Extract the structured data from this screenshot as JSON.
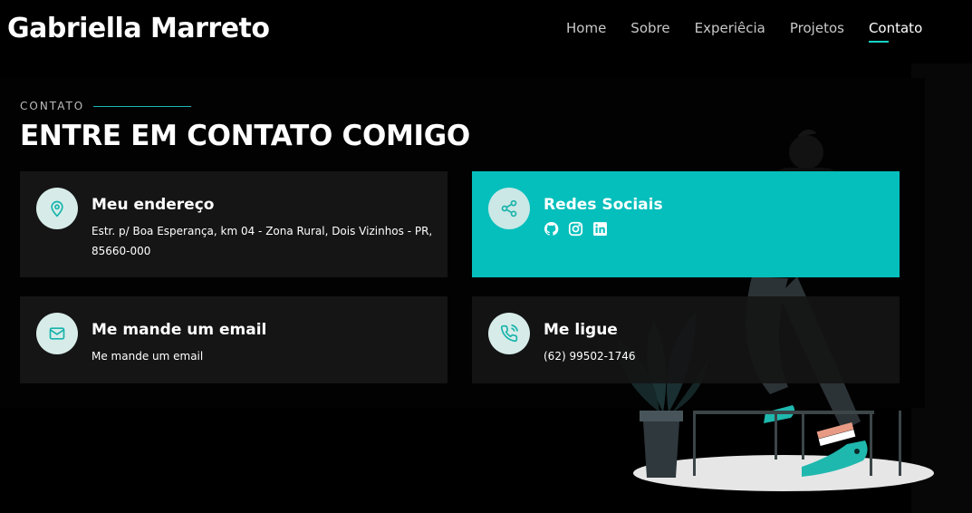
{
  "brand": "Gabriella Marreto",
  "nav": [
    "Home",
    "Sobre",
    "Experiêcia",
    "Projetos",
    "Contato"
  ],
  "nav_active": "Contato",
  "accent": "#18d2c8",
  "card_teal": "#05bfbc",
  "section": {
    "eyebrow": "CONTATO",
    "title": "ENTRE EM CONTATO COMIGO"
  },
  "cards": {
    "address": {
      "icon": "map-pin-icon",
      "title": "Meu endereço",
      "text": "Estr. p/ Boa Esperança, km 04 - Zona Rural, Dois Vizinhos - PR, 85660-000"
    },
    "social": {
      "icon": "share-icon",
      "title": "Redes Sociais",
      "links": [
        "github-icon",
        "instagram-icon",
        "linkedin-icon"
      ]
    },
    "email": {
      "icon": "mail-icon",
      "title": "Me mande um email",
      "text": "Me mande um email"
    },
    "phone": {
      "icon": "phone-icon",
      "title": "Me ligue",
      "text": "(62) 99502-1746"
    }
  }
}
